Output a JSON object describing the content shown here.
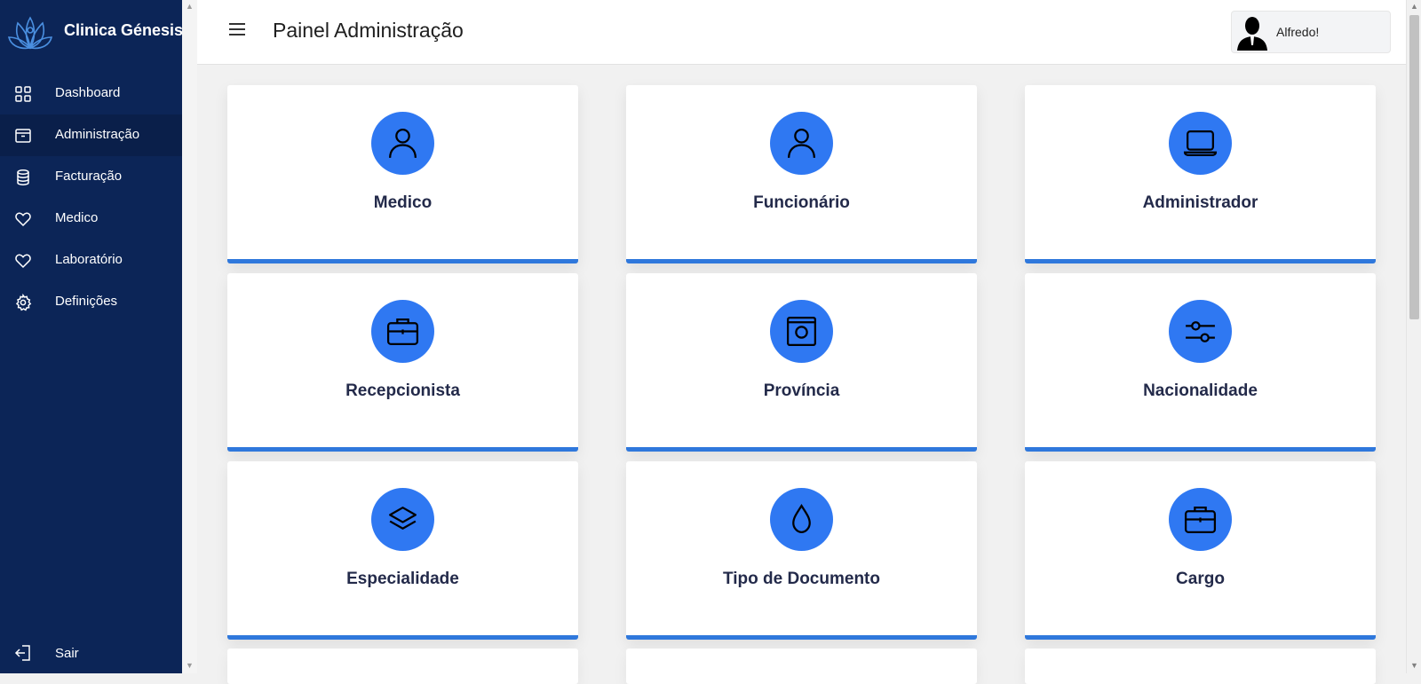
{
  "brand": {
    "name": "Clinica Génesis"
  },
  "sidebar": {
    "items": [
      {
        "label": "Dashboard",
        "icon": "grid-icon"
      },
      {
        "label": "Administração",
        "icon": "archive-icon"
      },
      {
        "label": "Facturação",
        "icon": "database-icon"
      },
      {
        "label": "Medico",
        "icon": "heart-icon"
      },
      {
        "label": "Laboratório",
        "icon": "heart-icon"
      },
      {
        "label": "Definições",
        "icon": "gear-icon"
      }
    ],
    "active": "Administração",
    "logout": {
      "label": "Sair",
      "icon": "logout-icon"
    }
  },
  "header": {
    "title": "Painel Administração",
    "menu_icon": "hamburger-icon",
    "user": {
      "name": "Alfredo!",
      "avatar": "user-silhouette"
    }
  },
  "cards": [
    {
      "label": "Medico",
      "icon": "user-icon"
    },
    {
      "label": "Funcionário",
      "icon": "user-icon"
    },
    {
      "label": "Administrador",
      "icon": "monitor-icon"
    },
    {
      "label": "Recepcionista",
      "icon": "briefcase-icon"
    },
    {
      "label": "Província",
      "icon": "image-frame-icon"
    },
    {
      "label": "Nacionalidade",
      "icon": "sliders-icon"
    },
    {
      "label": "Especialidade",
      "icon": "layers-icon"
    },
    {
      "label": "Tipo de Documento",
      "icon": "droplet-icon"
    },
    {
      "label": "Cargo",
      "icon": "briefcase-icon"
    }
  ],
  "colors": {
    "sidebar_bg": "#0c2557",
    "sidebar_active": "#0a1f4a",
    "accent": "#2f78f2",
    "card_border": "#2f78dc",
    "card_text": "#232a4a"
  }
}
